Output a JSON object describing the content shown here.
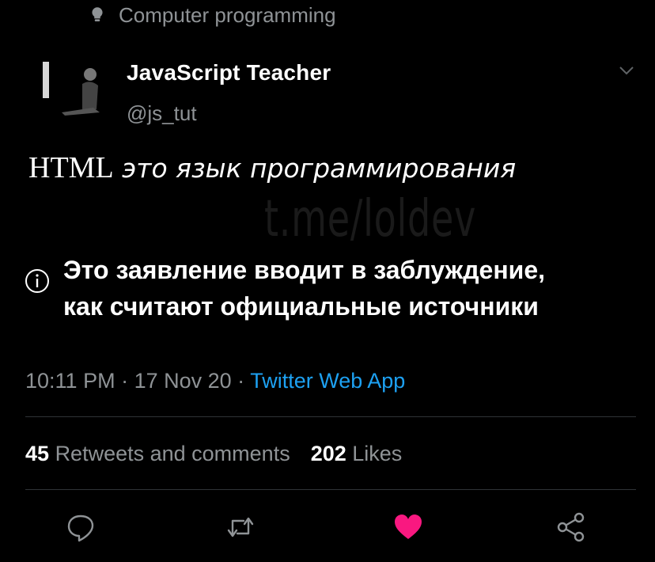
{
  "topic": {
    "icon": "lightbulb-icon",
    "label": "Computer programming"
  },
  "author": {
    "name": "JavaScript Teacher",
    "handle": "@js_tut",
    "menu_icon": "chevron-down-icon"
  },
  "tweet": {
    "text_serif_part": "HTML",
    "text_rest": " это язык программирования"
  },
  "watermark": "t.me/loldev",
  "notice": {
    "icon": "info-icon",
    "line1": "Это заявление вводит в заблуждение,",
    "line2": "как считают официальные источники"
  },
  "meta": {
    "time": "10:11 PM",
    "sep1": " · ",
    "date": "17 Nov 20",
    "sep2": " · ",
    "app": "Twitter Web App"
  },
  "stats": {
    "retweets_count": "45",
    "retweets_label": "Retweets and comments",
    "likes_count": "202",
    "likes_label": "Likes"
  },
  "actions": {
    "reply_icon": "reply-icon",
    "retweet_icon": "retweet-icon",
    "like_icon": "heart-icon",
    "share_icon": "share-icon"
  },
  "colors": {
    "background": "#000000",
    "secondary_text": "#8f9396",
    "link": "#1da1f2",
    "like": "#f91880"
  }
}
